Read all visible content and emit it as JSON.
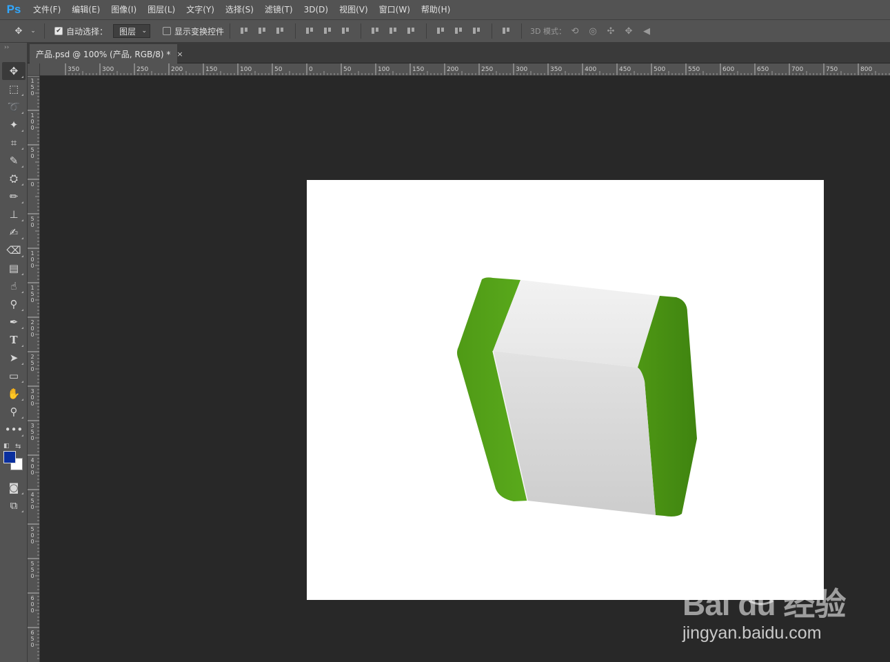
{
  "app": {
    "logo": "Ps"
  },
  "menu": [
    "文件(F)",
    "编辑(E)",
    "图像(I)",
    "图层(L)",
    "文字(Y)",
    "选择(S)",
    "滤镜(T)",
    "3D(D)",
    "视图(V)",
    "窗口(W)",
    "帮助(H)"
  ],
  "options": {
    "auto_select_label": "自动选择：",
    "auto_select_checked": true,
    "auto_select_target": "图层",
    "show_transform_label": "显示变换控件",
    "show_transform_checked": false,
    "mode_3d_label": "3D 模式："
  },
  "document_tab": {
    "title": "产品.psd @ 100% (产品, RGB/8) *",
    "close": "×"
  },
  "ruler_top": [
    "350",
    "300",
    "250",
    "200",
    "150",
    "100",
    "50",
    "0",
    "50",
    "100",
    "150",
    "200",
    "250",
    "300",
    "350",
    "400",
    "450",
    "500",
    "550",
    "600",
    "650",
    "700",
    "750",
    "800"
  ],
  "ruler_left": [
    "150",
    "100",
    "50",
    "0",
    "50",
    "100",
    "150",
    "200",
    "250",
    "300",
    "350",
    "400",
    "450",
    "500",
    "550",
    "600",
    "650"
  ],
  "colors": {
    "foreground": "#0a2f9e",
    "background": "#ffffff",
    "accent": "#31a8ff"
  },
  "tools": [
    "move-icon",
    "marquee-icon",
    "lasso-icon",
    "magic-wand-icon",
    "crop-icon",
    "eyedropper-icon",
    "patch-icon",
    "brush-icon",
    "stamp-icon",
    "history-brush-icon",
    "eraser-icon",
    "gradient-icon",
    "smudge-icon",
    "dodge-icon",
    "pen-icon",
    "type-icon",
    "path-select-icon",
    "rectangle-icon",
    "hand-icon",
    "zoom-icon",
    "more-icon"
  ],
  "watermark": {
    "logo": "Bai du 经验",
    "site": "jingyan.baidu.com"
  }
}
